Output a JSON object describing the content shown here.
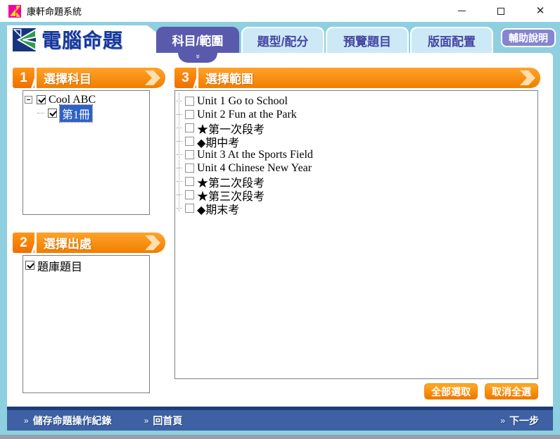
{
  "window": {
    "title": "康軒命題系統"
  },
  "header": {
    "logo": "電腦命題",
    "pointer": "»",
    "help": "輔助說明",
    "tabs": [
      {
        "label": "科目/範圍",
        "active": true
      },
      {
        "label": "題型/配分",
        "active": false
      },
      {
        "label": "預覽題目",
        "active": false
      },
      {
        "label": "版面配置",
        "active": false
      }
    ]
  },
  "subject": {
    "number": "1",
    "title": "選擇科目",
    "root_label": "Cool ABC",
    "root_checked": true,
    "child_label": "第1冊",
    "child_checked": true,
    "child_selected": true
  },
  "source": {
    "number": "2",
    "title": "選擇出處",
    "item": "題庫題目",
    "checked": true
  },
  "range": {
    "number": "3",
    "title": "選擇範圍",
    "items": [
      {
        "label": "Unit 1 Go to School",
        "checked": false
      },
      {
        "label": "Unit 2 Fun at the Park",
        "checked": false
      },
      {
        "label": "★第一次段考",
        "checked": false
      },
      {
        "label": "◆期中考",
        "checked": false
      },
      {
        "label": "Unit 3 At the Sports Field",
        "checked": false
      },
      {
        "label": "Unit 4 Chinese New Year",
        "checked": false
      },
      {
        "label": "★第二次段考",
        "checked": false
      },
      {
        "label": "★第三次段考",
        "checked": false
      },
      {
        "label": "◆期末考",
        "checked": false
      }
    ],
    "select_all": "全部選取",
    "deselect_all": "取消全選"
  },
  "footer": {
    "chevron": "»",
    "save": "儲存命題操作紀錄",
    "home": "回首頁",
    "next": "下一步"
  },
  "colors": {
    "accent_orange": "#f17e00",
    "active_tab_purple": "#5a5aad",
    "selection_blue": "#2f62c5",
    "band_cyan": "#8ecfe0",
    "footer_blue": "#3e61a4"
  }
}
